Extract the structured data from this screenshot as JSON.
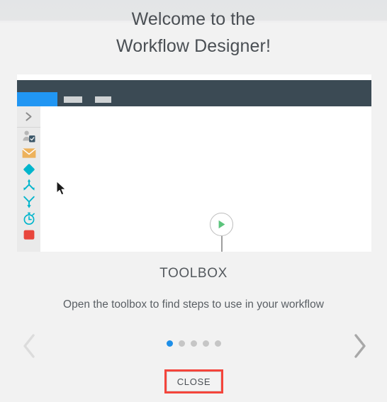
{
  "dialog": {
    "title_line1": "Welcome to the",
    "title_line2": "Workflow Designer!",
    "caption_title": "TOOLBOX",
    "caption_body": "Open the toolbox to find steps to use in your workflow",
    "close_label": "CLOSE",
    "prev_label": "‹",
    "next_label": "›",
    "accent_color": "#1e8fe8",
    "highlight_color": "#f4453c"
  },
  "carousel": {
    "total_slides": 5,
    "current_slide": 1,
    "dots": [
      {
        "index": 1,
        "active": true
      },
      {
        "index": 2,
        "active": false
      },
      {
        "index": 3,
        "active": false
      },
      {
        "index": 4,
        "active": false
      },
      {
        "index": 5,
        "active": false
      }
    ]
  },
  "screenshot": {
    "navbar": {
      "background": "#3b4a54",
      "active_tab_color": "#2196f3",
      "items": [
        {
          "name": "active-tab",
          "label": ""
        },
        {
          "name": "tab-placeholder-1",
          "label": ""
        },
        {
          "name": "tab-placeholder-2",
          "label": ""
        }
      ]
    },
    "toolbox_rail": {
      "toggle_icon": "chevron-right-icon",
      "items": [
        {
          "icon": "user-task-icon",
          "color": "#3b5668"
        },
        {
          "icon": "mail-icon",
          "color": "#edb25c"
        },
        {
          "icon": "diamond-decision-icon",
          "color": "#00b5cc"
        },
        {
          "icon": "split-branch-icon",
          "color": "#00b5cc"
        },
        {
          "icon": "merge-join-icon",
          "color": "#00b5cc"
        },
        {
          "icon": "timer-icon",
          "color": "#00b5cc"
        },
        {
          "icon": "stop-icon",
          "color": "#e8463c"
        }
      ]
    },
    "canvas": {
      "start_node": {
        "icon": "play-icon",
        "color": "#5cc47c"
      },
      "connector": {
        "icon": "arrow-down-icon",
        "color": "#9e9e9e"
      },
      "placeholder_node": {
        "icon": "empty-step-placeholder",
        "color": "#c3c3c3"
      }
    },
    "cursor": {
      "icon": "mouse-pointer-icon"
    }
  }
}
